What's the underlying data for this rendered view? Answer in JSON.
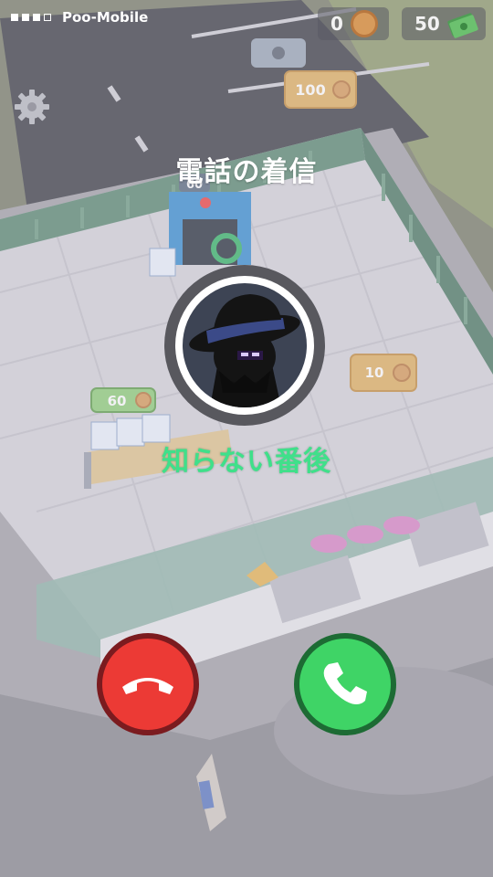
{
  "status_bar": {
    "signal_bars": [
      true,
      true,
      true,
      false
    ],
    "carrier": "Poo-Mobile"
  },
  "currency": {
    "coins": "0",
    "cash": "50"
  },
  "world_labels": {
    "parking_price": "100",
    "counter_price": "60",
    "shelf_price": "10",
    "machine_count": "60"
  },
  "call": {
    "title": "電話の着信",
    "caller_name": "知らない番後"
  },
  "colors": {
    "accept": "#3fd466",
    "decline": "#ec3a35",
    "caller_name": "#3fe08a"
  },
  "icons": {
    "settings": "gear-icon",
    "coin": "coin-icon",
    "cash": "cash-icon",
    "accept": "phone-icon",
    "decline": "hang-up-icon"
  }
}
